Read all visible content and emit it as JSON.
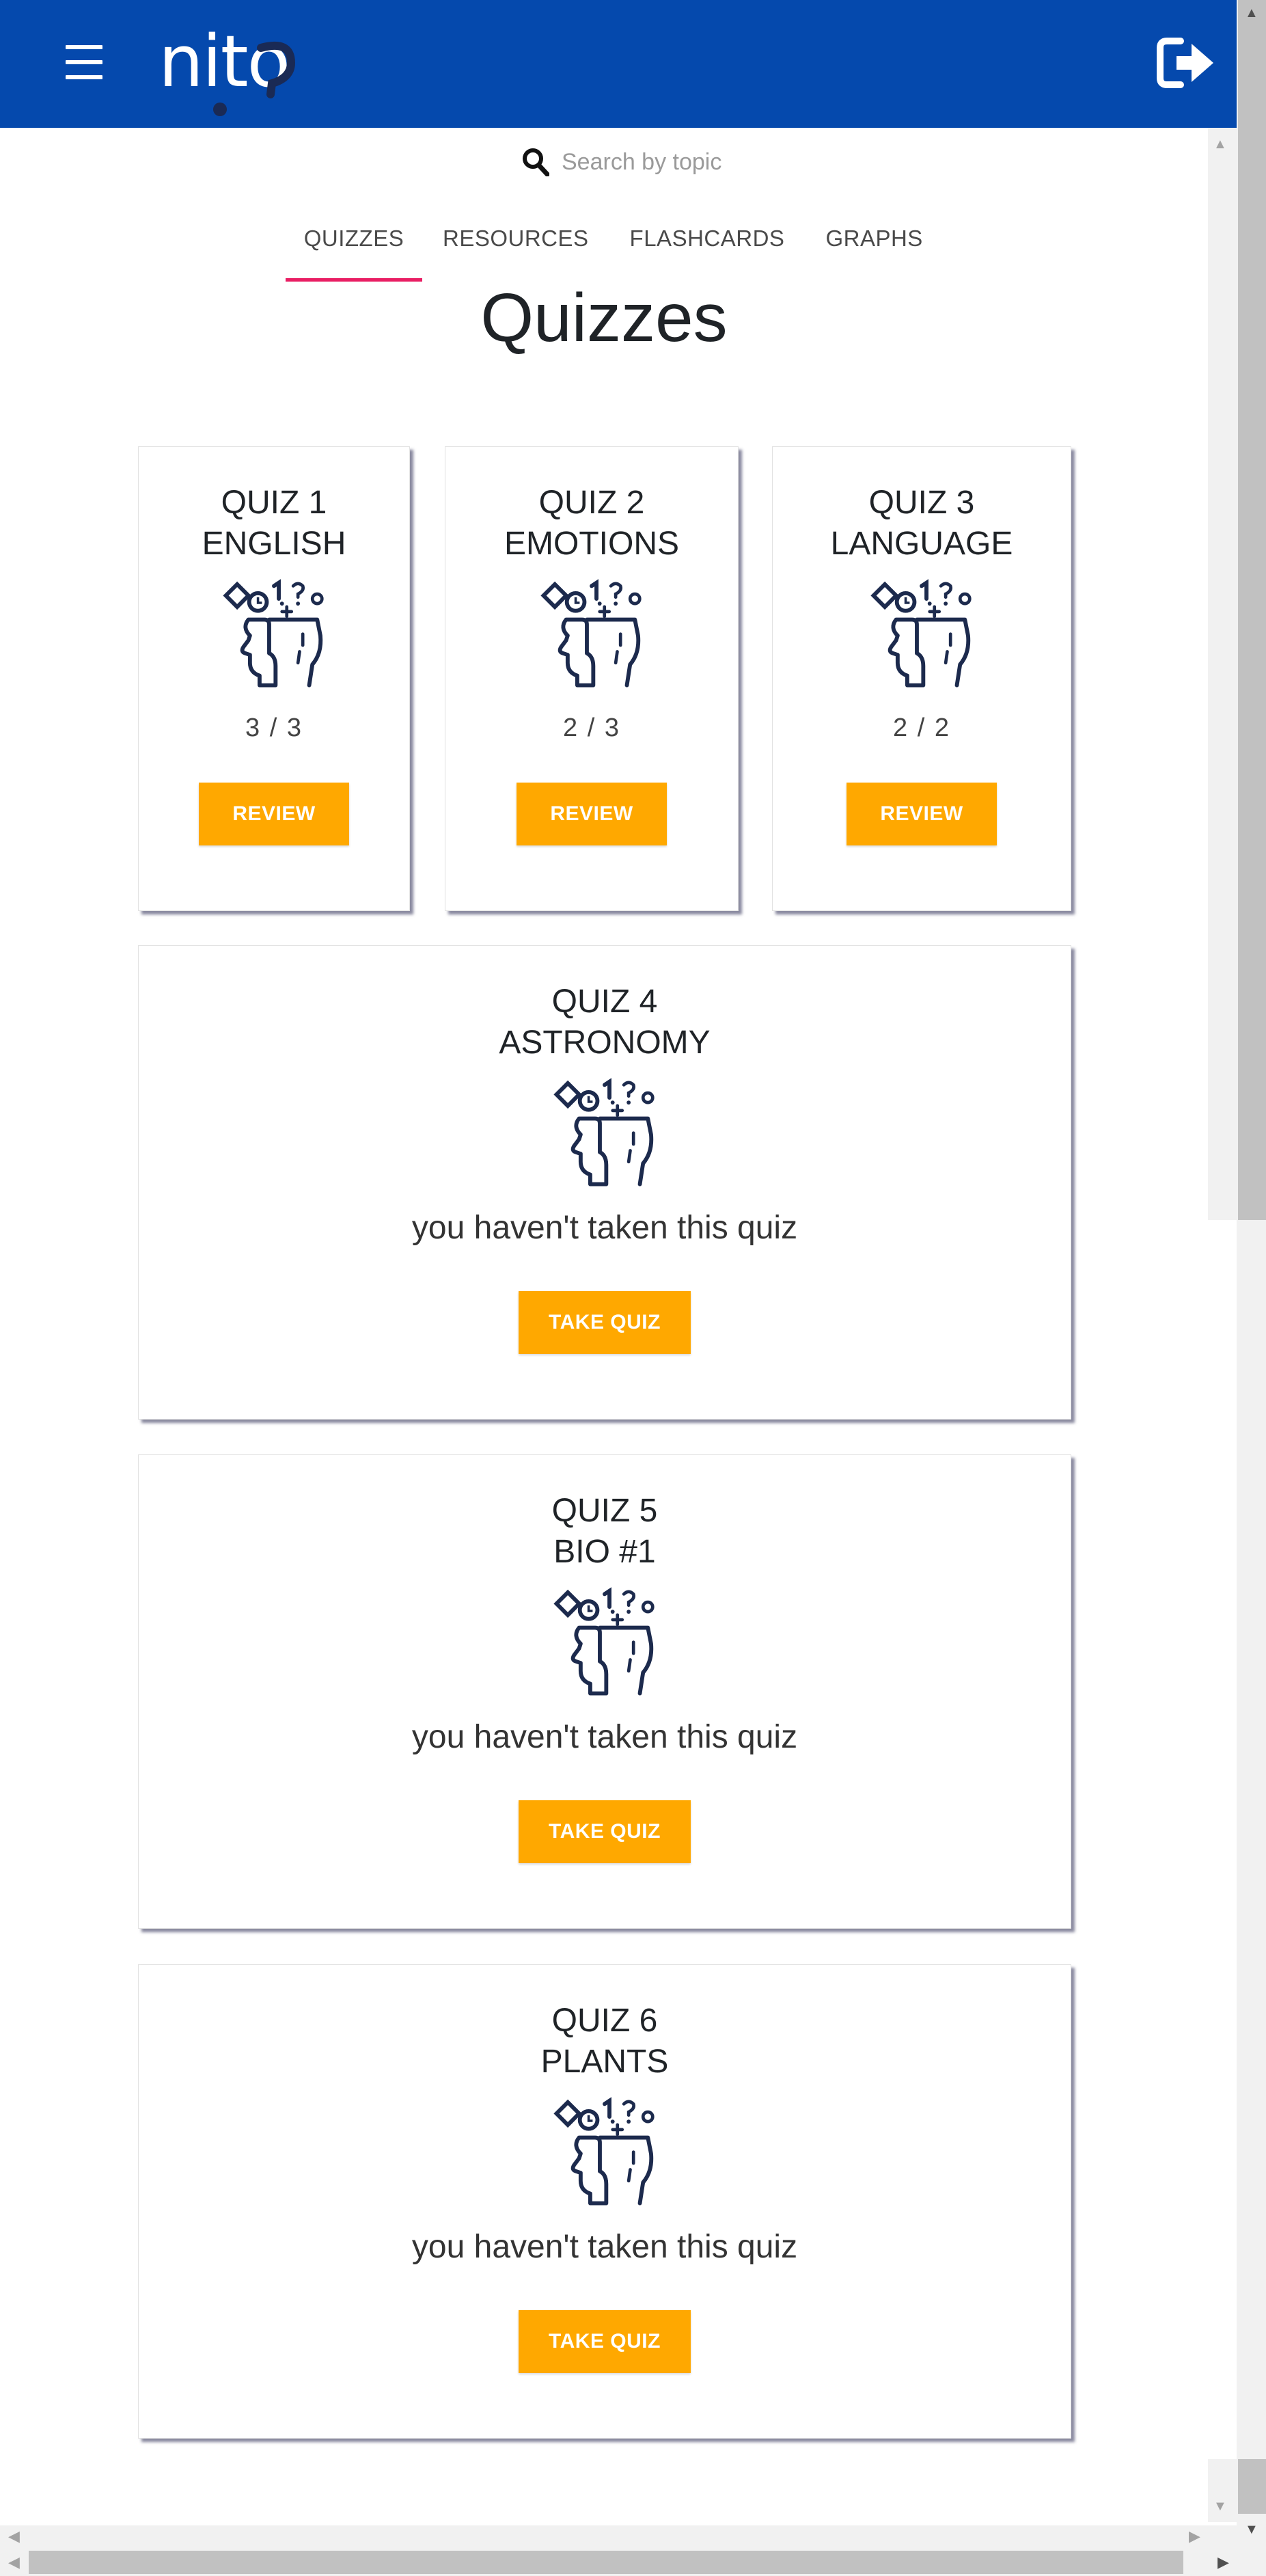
{
  "header": {
    "logo_text": "nito",
    "menu_icon": "hamburger-icon",
    "logout_icon": "logout-icon",
    "brand_color": "#0549ad"
  },
  "search": {
    "placeholder": "Search by topic",
    "icon": "search-icon"
  },
  "tabs": [
    {
      "label": "QUIZZES",
      "active": true
    },
    {
      "label": "RESOURCES",
      "active": false
    },
    {
      "label": "FLASHCARDS",
      "active": false
    },
    {
      "label": "GRAPHS",
      "active": false
    }
  ],
  "page_title": "Quizzes",
  "quizzes": [
    {
      "title_line1": "QUIZ 1",
      "title_line2": "ENGLISH",
      "score": "3 / 3",
      "button": "REVIEW"
    },
    {
      "title_line1": "QUIZ 2",
      "title_line2": "EMOTIONS",
      "score": "2 / 3",
      "button": "REVIEW"
    },
    {
      "title_line1": "QUIZ 3",
      "title_line2": "LANGUAGE",
      "score": "2 / 2",
      "button": "REVIEW"
    },
    {
      "title_line1": "QUIZ 4",
      "title_line2": "ASTRONOMY",
      "notice": "you haven't taken this quiz",
      "button": "TAKE QUIZ"
    },
    {
      "title_line1": "QUIZ 5",
      "title_line2": "BIO #1",
      "notice": "you haven't taken this quiz",
      "button": "TAKE QUIZ"
    },
    {
      "title_line1": "QUIZ 6",
      "title_line2": "PLANTS",
      "notice": "you haven't taken this quiz",
      "button": "TAKE QUIZ"
    }
  ],
  "colors": {
    "accent_button": "#ffa800",
    "active_tab_underline": "#e91e63",
    "icon_stroke": "#1c2a4d"
  }
}
